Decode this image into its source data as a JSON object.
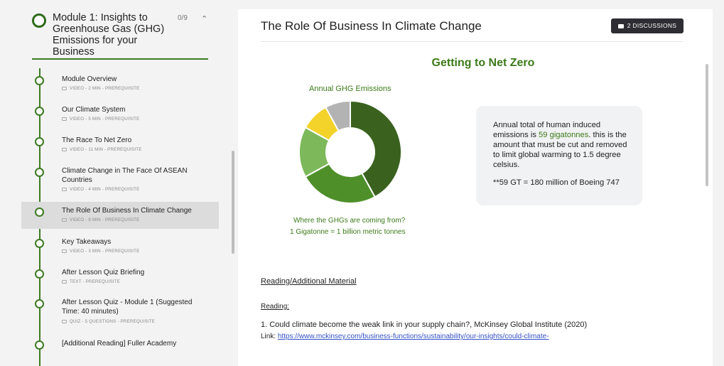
{
  "module": {
    "title": "Module 1: Insights to Greenhouse Gas (GHG) Emissions for your Business",
    "progress": "0/9",
    "collapse_icon": "chevron-up-icon"
  },
  "lessons": [
    {
      "title": "Module Overview",
      "meta": "VIDEO - 2 MIN - PREREQUISITE",
      "icon": "video-icon"
    },
    {
      "title": "Our Climate System",
      "meta": "VIDEO - 5 MIN - PREREQUISITE",
      "icon": "video-icon"
    },
    {
      "title": "The Race To Net Zero",
      "meta": "VIDEO - 11 MIN - PREREQUISITE",
      "icon": "video-icon"
    },
    {
      "title": "Climate Change in The Face Of ASEAN Countries",
      "meta": "VIDEO - 4 MIN - PREREQUISITE",
      "icon": "video-icon"
    },
    {
      "title": "The Role Of Business In Climate Change",
      "meta": "VIDEO - 9 MIN - PREREQUISITE",
      "icon": "video-icon",
      "active": true
    },
    {
      "title": "Key Takeaways",
      "meta": "VIDEO - 3 MIN - PREREQUISITE",
      "icon": "video-icon"
    },
    {
      "title": "After Lesson Quiz Briefing",
      "meta": "TEXT - PREREQUISITE",
      "icon": "text-icon"
    },
    {
      "title": "After Lesson Quiz - Module 1 (Suggested Time: 40 minutes)",
      "meta": "QUIZ - 5 QUESTIONS - PREREQUISITE",
      "icon": "quiz-icon"
    },
    {
      "title": "[Additional Reading] Fuller Academy",
      "meta": "",
      "icon": ""
    }
  ],
  "main": {
    "title": "The Role Of Business In Climate Change",
    "discussions_label": "2 DISCUSSIONS",
    "section_title": "Getting to Net Zero",
    "chart_caption_line1": "Where the GHGs are coming from?",
    "chart_caption_line2": "1 Gigatonne = 1 billion metric tonnes",
    "info_pre": "Annual total of human induced emissions is ",
    "info_highlight": "59 gigatonnes",
    "info_post": ". this is the amount that must be cut and removed to limit global warming to 1.5 degree celsius.",
    "info_note": "**59 GT = 180 million of Boeing 747",
    "reading_heading": "Reading/Additional Material",
    "reading_label": "Reading:",
    "reference_1": "1.  Could climate become the weak link in your supply chain?, McKinsey Global Institute (2020)",
    "reference_1_link_label": "Link: ",
    "reference_1_url": "https://www.mckinsey.com/business-functions/sustainability/our-insights/could-climate-"
  },
  "colors": {
    "accent": "#3d7a1a",
    "button_dark": "#2d2d33",
    "link": "#3350c6"
  },
  "chart_data": {
    "type": "pie",
    "title": "Annual GHG Emissions",
    "categories": [
      "",
      "",
      "",
      "",
      ""
    ],
    "values": [
      42,
      25,
      16,
      9,
      8
    ],
    "colors": [
      "#3a621e",
      "#4e8f2a",
      "#7db85b",
      "#f3d22a",
      "#b3b3b3"
    ],
    "style": "donut"
  }
}
